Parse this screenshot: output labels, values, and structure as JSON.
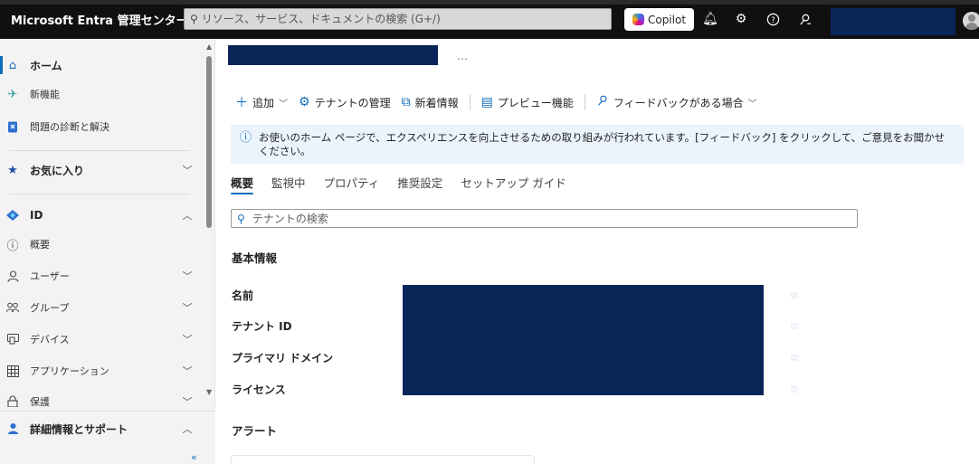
{
  "topbar": {
    "brand": "Microsoft Entra 管理センター",
    "search_placeholder": "リソース、サービス、ドキュメントの検索 (G+/)",
    "copilot_label": "Copilot",
    "icons": [
      "bell-icon",
      "gear-icon",
      "help-icon",
      "feedback-icon"
    ]
  },
  "sidebar": {
    "items": [
      {
        "label": "ホーム",
        "icon": "home-icon"
      },
      {
        "label": "新機能",
        "icon": "rocket-icon"
      },
      {
        "label": "問題の診断と解決",
        "icon": "diagnose-icon"
      },
      {
        "label": "お気に入り",
        "icon": "star-icon"
      },
      {
        "label": "ID",
        "icon": "identity-icon"
      },
      {
        "label": "概要",
        "icon": "info-icon"
      },
      {
        "label": "ユーザー",
        "icon": "user-icon"
      },
      {
        "label": "グループ",
        "icon": "group-icon"
      },
      {
        "label": "デバイス",
        "icon": "device-icon"
      },
      {
        "label": "アプリケーション",
        "icon": "apps-icon"
      },
      {
        "label": "保護",
        "icon": "lock-icon"
      },
      {
        "label": "詳細情報とサポート",
        "icon": "support-icon"
      }
    ],
    "collapse_glyph": "«"
  },
  "main": {
    "more_glyph": "…",
    "commands": [
      {
        "label": "追加"
      },
      {
        "label": "テナントの管理"
      },
      {
        "label": "新着情報"
      },
      {
        "label": "プレビュー機能"
      },
      {
        "label": "フィードバックがある場合"
      }
    ],
    "banner_text": "お使いのホーム ページで、エクスペリエンスを向上させるための取り組みが行われています。[フィードバック] をクリックして、ご意見をお聞かせください。",
    "tabs": [
      "概要",
      "監視中",
      "プロパティ",
      "推奨設定",
      "セットアップ ガイド"
    ],
    "tenant_search_placeholder": "テナントの検索",
    "basic_info_title": "基本情報",
    "fields": [
      "名前",
      "テナント ID",
      "プライマリ ドメイン",
      "ライセンス"
    ],
    "alerts_title": "アラート"
  },
  "colors": {
    "accent": "#0f6cbd",
    "redaction": "#0a2558",
    "topbar": "#101010",
    "sidebar": "#f3f3f3",
    "banner": "#ebf3fc"
  }
}
